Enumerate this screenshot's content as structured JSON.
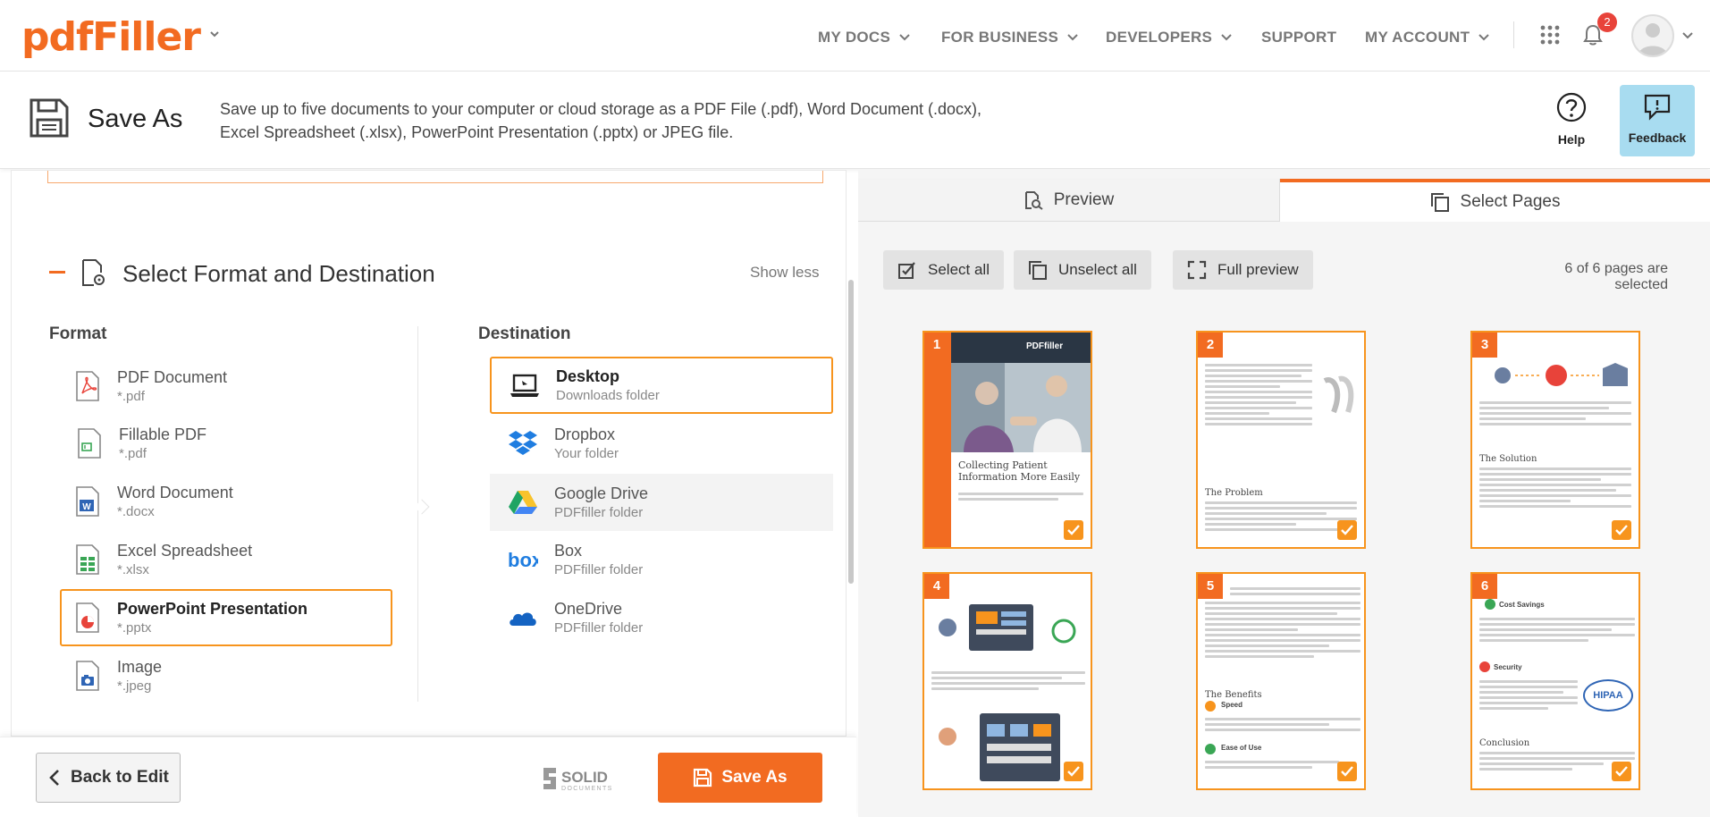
{
  "header": {
    "logo": "pdfFiller",
    "nav": [
      "MY DOCS",
      "FOR BUSINESS",
      "DEVELOPERS",
      "SUPPORT",
      "MY ACCOUNT"
    ],
    "notifications_count": "2",
    "accent": "#f26b21"
  },
  "subbar": {
    "title": "Save As",
    "description_line1": "Save up to five documents to your computer or cloud storage as a PDF File (.pdf), Word Document (.docx),",
    "description_line2": "Excel Spreadsheet (.xlsx), PowerPoint Presentation (.pptx) or JPEG file.",
    "help_label": "Help",
    "feedback_label": "Feedback"
  },
  "section": {
    "title": "Select Format and Destination",
    "toggle_label": "Show less",
    "format_heading": "Format",
    "destination_heading": "Destination",
    "formats": [
      {
        "name": "PDF Document",
        "ext": "*.pdf",
        "icon": "pdf-file-icon"
      },
      {
        "name": "Fillable PDF",
        "ext": "*.pdf",
        "icon": "fillable-pdf-icon"
      },
      {
        "name": "Word Document",
        "ext": "*.docx",
        "icon": "word-file-icon"
      },
      {
        "name": "Excel Spreadsheet",
        "ext": "*.xlsx",
        "icon": "excel-file-icon"
      },
      {
        "name": "PowerPoint Presentation",
        "ext": "*.pptx",
        "icon": "powerpoint-file-icon"
      },
      {
        "name": "Image",
        "ext": "*.jpeg",
        "icon": "image-file-icon"
      }
    ],
    "selected_format": "PowerPoint Presentation",
    "destinations": [
      {
        "name": "Desktop",
        "sub": "Downloads folder",
        "icon": "laptop-icon"
      },
      {
        "name": "Dropbox",
        "sub": "Your folder",
        "icon": "dropbox-icon"
      },
      {
        "name": "Google Drive",
        "sub": "PDFfiller folder",
        "icon": "google-drive-icon"
      },
      {
        "name": "Box",
        "sub": "PDFfiller folder",
        "icon": "box-icon"
      },
      {
        "name": "OneDrive",
        "sub": "PDFfiller folder",
        "icon": "onedrive-icon"
      }
    ],
    "selected_destination": "Desktop"
  },
  "footer": {
    "back_label": "Back to Edit",
    "solid_logo": "SOLID",
    "solid_logo_sub": "DOCUMENTS",
    "save_label": "Save As"
  },
  "right": {
    "tab_preview": "Preview",
    "tab_select": "Select Pages",
    "select_all": "Select all",
    "unselect_all": "Unselect all",
    "full_preview": "Full preview",
    "selected_status": "6 of 6 pages are selected",
    "page_numbers": [
      "1",
      "2",
      "3",
      "4",
      "5",
      "6"
    ],
    "page1_title": "Collecting Patient Information More Easily",
    "page1_brand": "PDFfiller",
    "page2_heading": "The Problem",
    "page3_heading": "The Solution",
    "page5_heading": "The Benefits",
    "page5_speed": "Speed",
    "page5_ease": "Ease of Use",
    "page6_cost": "Cost Savings",
    "page6_security": "Security",
    "page6_hipaa": "HIPAA",
    "page6_conclusion": "Conclusion"
  }
}
